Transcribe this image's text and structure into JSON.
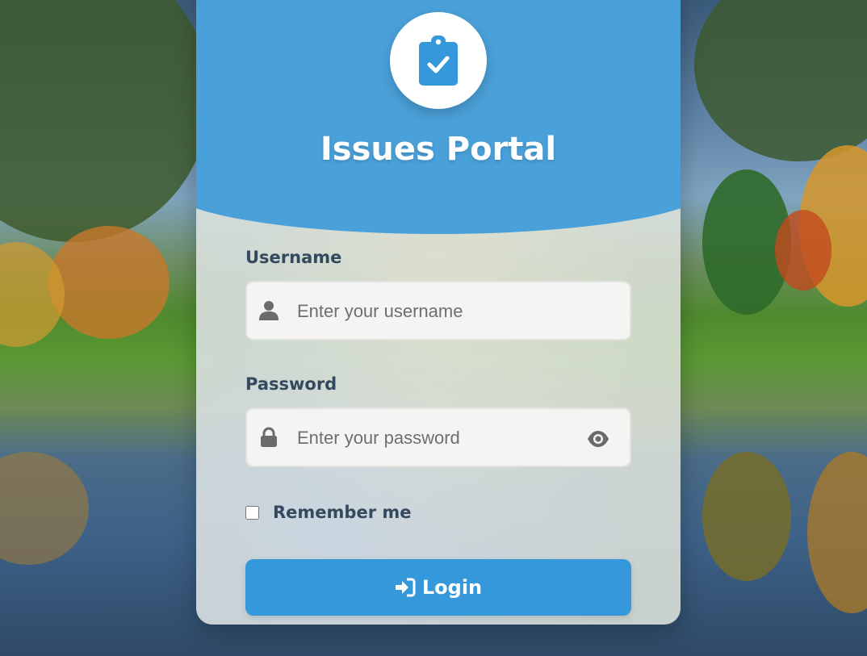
{
  "app": {
    "title": "Issues Portal",
    "logo_icon": "clipboard-check-icon"
  },
  "form": {
    "username": {
      "label": "Username",
      "placeholder": "Enter your username",
      "value": "",
      "icon": "user-icon"
    },
    "password": {
      "label": "Password",
      "placeholder": "Enter your password",
      "value": "",
      "icon": "lock-icon",
      "toggle_icon": "eye-icon"
    },
    "remember": {
      "label": "Remember me",
      "checked": false
    },
    "submit": {
      "label": "Login",
      "icon": "sign-in-icon"
    }
  },
  "colors": {
    "header": "#4aa0d8",
    "button": "#3498db",
    "label_text": "#34495e",
    "icon_gray": "#6b6b6b"
  }
}
